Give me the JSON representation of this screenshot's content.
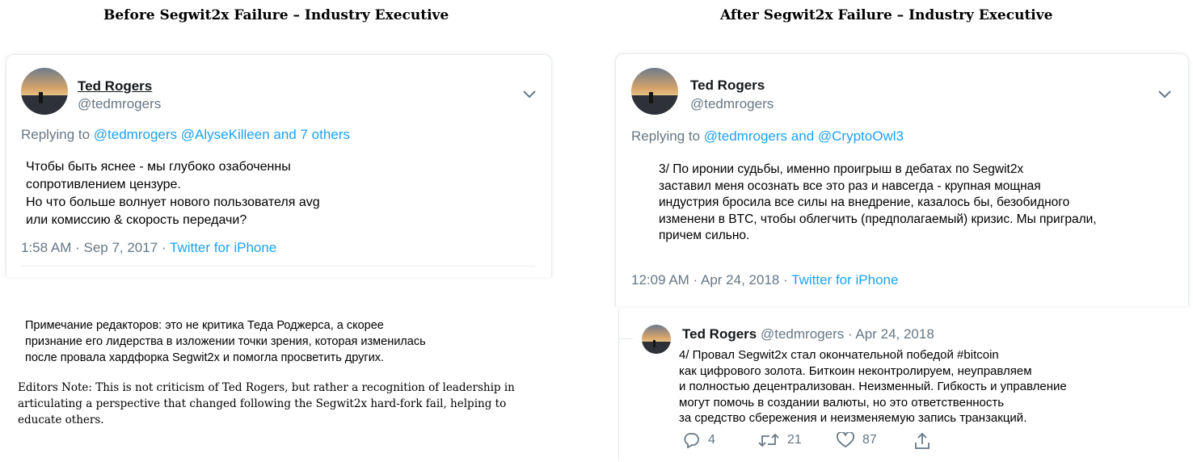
{
  "headings": {
    "left": "Before Segwit2x Failure – Industry Executive",
    "right": "After Segwit2x Failure – Industry Executive"
  },
  "left_tweet": {
    "author_name": "Ted Rogers",
    "author_handle": "@tedmrogers",
    "replying_prefix": "Replying to",
    "replying_to": [
      "@tedmrogers",
      "@AlyseKilleen",
      "and 7 others"
    ],
    "text_lines": [
      "Чтобы быть яснее - мы глубоко озабоченны",
      "сопротивлением цензуре.",
      "Но что больше волнует нового пользователя avg",
      "или комиссию & скорость передачи?"
    ],
    "time": "1:58 AM · Sep 7, 2017 ·",
    "source": "Twitter for iPhone"
  },
  "right_tweet": {
    "author_name": "Ted Rogers",
    "author_handle": "@tedmrogers",
    "replying_prefix": "Replying to",
    "replying_to": [
      "@tedmrogers",
      "and",
      "@CryptoOwl3"
    ],
    "text_lines": [
      "3/ По иронии судьбы, именно проигрыш в дебатах по Segwit2x",
      "заставил меня осознать все это раз и навсегда - крупная мощная",
      "индустрия бросила все силы на внедрение, казалось бы, безобидного",
      "изменени в BTC, чтобы облегчить (предполагаемый) кризис. Мы приграли,",
      "причем сильно."
    ],
    "time": "12:09 AM · Apr 24, 2018 ·",
    "source": "Twitter for iPhone"
  },
  "reply_tweet": {
    "author_name": "Ted Rogers",
    "author_handle": "@tedmrogers",
    "date": "· Apr 24, 2018",
    "text_lines": [
      "4/ Провал Segwit2x стал окончательной победой #bitcoin",
      "как цифрового золота. Биткоин неконтролируем, неуправляем",
      "и полностью децентрализован. Неизменный. Гибкость и управление",
      "могут помочь в создании валюты, но это ответственность",
      "за средство сбережения и неизменяемую запись транзакций."
    ],
    "replies": "4",
    "retweets": "21",
    "likes": "87"
  },
  "editor_note_ru": [
    "Примечание редакторов: это не критика Теда Роджерса, а скорее",
    "признание его лидерства в изложении точки зрения, которая изменилась",
    "после провала хардфорка Segwit2x и помогла просветить других."
  ],
  "editor_note_en": [
    "Editors Note: This is not criticism of Ted Rogers, but rather a recognition of leadership in",
    "articulating a perspective that changed following the Segwit2x hard-fork fail, helping to",
    "educate others."
  ],
  "icons": {
    "chevron": "chevron-down-icon",
    "reply": "reply-icon",
    "retweet": "retweet-icon",
    "like": "heart-icon",
    "share": "share-icon"
  },
  "colors": {
    "link": "#1da1f2",
    "muted": "#657786",
    "text": "#14171a"
  }
}
